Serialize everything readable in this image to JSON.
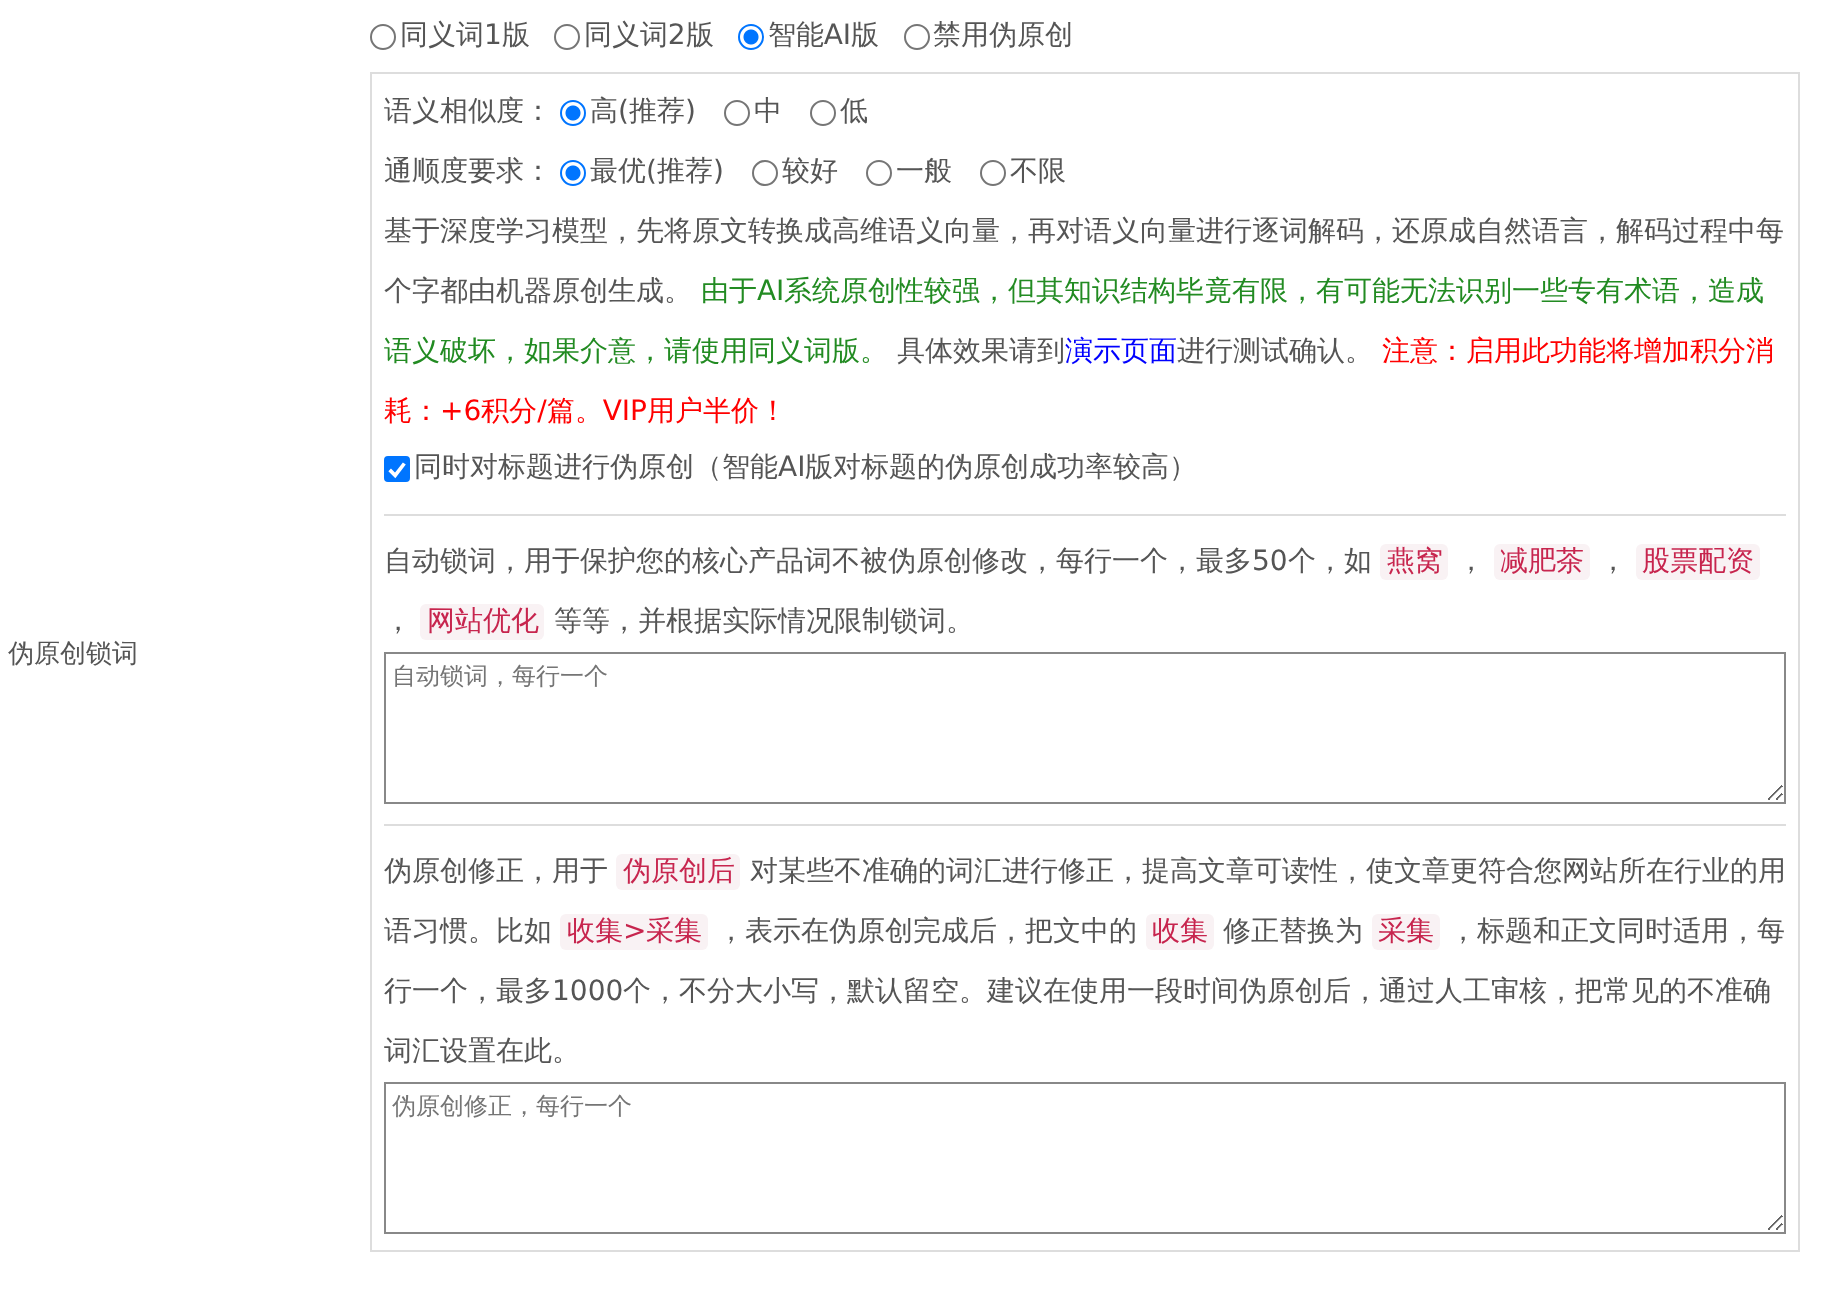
{
  "mode_options": [
    {
      "label": "同义词1版",
      "selected": false
    },
    {
      "label": "同义词2版",
      "selected": false
    },
    {
      "label": "智能AI版",
      "selected": true
    },
    {
      "label": "禁用伪原创",
      "selected": false
    }
  ],
  "similarity": {
    "label": "语义相似度：",
    "options": [
      {
        "label": "高(推荐)",
        "selected": true
      },
      {
        "label": "中",
        "selected": false
      },
      {
        "label": "低",
        "selected": false
      }
    ]
  },
  "fluency": {
    "label": "通顺度要求：",
    "options": [
      {
        "label": "最优(推荐)",
        "selected": true
      },
      {
        "label": "较好",
        "selected": false
      },
      {
        "label": "一般",
        "selected": false
      },
      {
        "label": "不限",
        "selected": false
      }
    ]
  },
  "ai_note": [
    {
      "kind": "plain",
      "text": "基于深度学习模型，先将原文转换成高维语义向量，再对语义向量进行逐词解码，还原成自然语言，解码过程中每个字都由机器原创生成。 "
    },
    {
      "kind": "green",
      "text": "由于AI系统原创性较强，但其知识结构毕竟有限，有可能无法识别一些专有术语，造成语义破坏，如果介意，请使用同义词版。"
    },
    {
      "kind": "plain",
      "text": " 具体效果请到"
    },
    {
      "kind": "link",
      "text": "演示页面"
    },
    {
      "kind": "plain",
      "text": "进行测试确认。 "
    },
    {
      "kind": "red",
      "text": "注意：启用此功能将增加积分消耗：+6积分/篇。VIP用户半价！"
    }
  ],
  "title_checkbox": {
    "label": "同时对标题进行伪原创（智能AI版对标题的伪原创成功率较高）",
    "checked": true
  },
  "lock_words": {
    "label": "伪原创锁词",
    "description": [
      {
        "kind": "plain",
        "text": "自动锁词，用于保护您的核心产品词不被伪原创修改，每行一个，最多50个，如 "
      },
      {
        "kind": "tag",
        "text": "燕窝"
      },
      {
        "kind": "plain",
        "text": " ， "
      },
      {
        "kind": "tag",
        "text": "减肥茶"
      },
      {
        "kind": "plain",
        "text": " ， "
      },
      {
        "kind": "tag",
        "text": "股票配资"
      },
      {
        "kind": "plain",
        "text": " ， "
      },
      {
        "kind": "tag",
        "text": "网站优化"
      },
      {
        "kind": "plain",
        "text": " 等等，并根据实际情况限制锁词。"
      }
    ],
    "placeholder": "自动锁词，每行一个"
  },
  "correction": {
    "description": [
      {
        "kind": "plain",
        "text": "伪原创修正，用于 "
      },
      {
        "kind": "tag",
        "text": "伪原创后"
      },
      {
        "kind": "plain",
        "text": " 对某些不准确的词汇进行修正，提高文章可读性，使文章更符合您网站所在行业的用语习惯。比如 "
      },
      {
        "kind": "tag",
        "text": "收集>采集"
      },
      {
        "kind": "plain",
        "text": " ，表示在伪原创完成后，把文中的 "
      },
      {
        "kind": "tag",
        "text": "收集"
      },
      {
        "kind": "plain",
        "text": " 修正替换为 "
      },
      {
        "kind": "tag",
        "text": "采集"
      },
      {
        "kind": "plain",
        "text": " ，标题和正文同时适用，每行一个，最多1000个，不分大小写，默认留空。建议在使用一段时间伪原创后，通过人工审核，把常见的不准确词汇设置在此。"
      }
    ],
    "placeholder": "伪原创修正，每行一个"
  }
}
